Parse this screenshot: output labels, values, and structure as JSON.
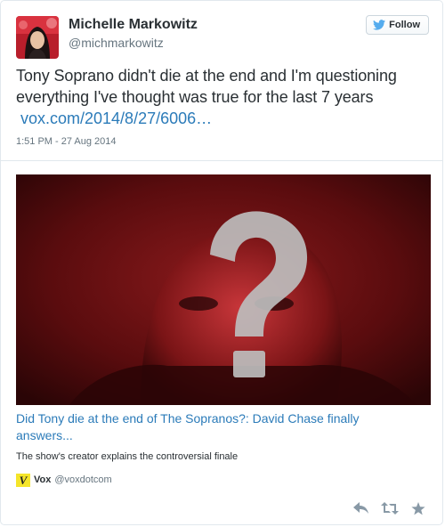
{
  "user": {
    "name": "Michelle Markowitz",
    "handle": "@michmarkowitz"
  },
  "follow_button": {
    "label": "Follow"
  },
  "tweet": {
    "text": "Tony Soprano didn't die at the end and I'm questioning everything I've thought was true for the last 7 years",
    "link": "vox.com/2014/8/27/6006…",
    "timestamp": "1:51 PM - 27 Aug 2014"
  },
  "card": {
    "title": "Did Tony die at the end of The Sopranos?: David Chase finally answers...",
    "description": "The show's creator explains the controversial finale",
    "source_logo": "V",
    "source_name": "Vox",
    "source_handle": "@voxdotcom"
  },
  "icons": {
    "follow": "bird-icon",
    "reply": "reply-icon",
    "retweet": "retweet-icon",
    "favorite": "star-icon"
  },
  "colors": {
    "link": "#2b7bb9",
    "text": "#292f33",
    "muted": "#66757f",
    "vox_yellow": "#f5e52a"
  }
}
